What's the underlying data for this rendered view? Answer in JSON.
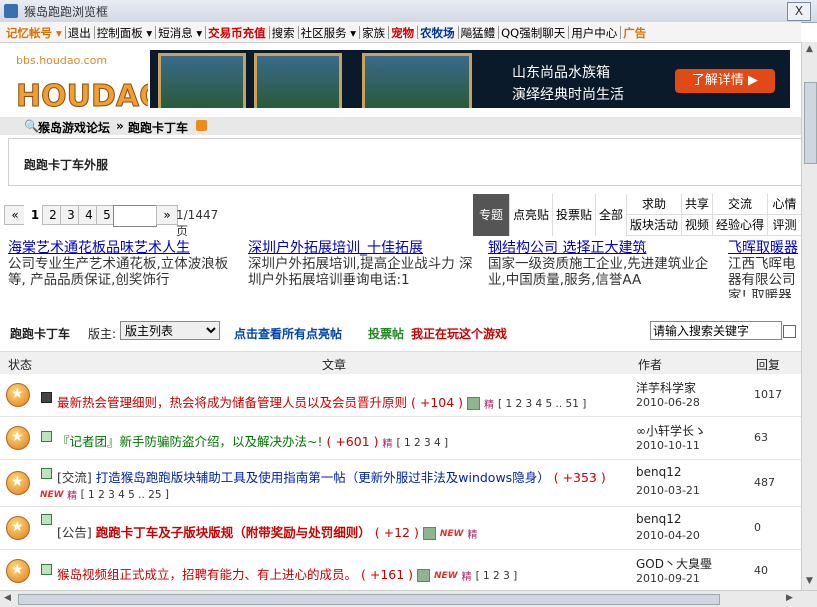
{
  "window": {
    "title": "猴岛跑跑浏览框",
    "close": "X"
  },
  "menu": [
    {
      "label": "记忆帐号 ▾",
      "style": "orange"
    },
    {
      "label": "退出",
      "style": ""
    },
    {
      "label": "控制面板 ▾",
      "style": ""
    },
    {
      "label": "短消息 ▾",
      "style": ""
    },
    {
      "label": "交易币充值",
      "style": "red"
    },
    {
      "label": "搜索",
      "style": ""
    },
    {
      "label": "社区服务 ▾",
      "style": ""
    },
    {
      "label": "家族",
      "style": ""
    },
    {
      "label": "宠物",
      "style": "red"
    },
    {
      "label": "农牧场",
      "style": "blueb"
    },
    {
      "label": "飚猛鳢",
      "style": ""
    },
    {
      "label": "QQ强制聊天",
      "style": ""
    },
    {
      "label": "用户中心",
      "style": ""
    },
    {
      "label": "广告",
      "style": "orange"
    }
  ],
  "logo": {
    "url_text": "bbs.houdao.com",
    "brand": "HOUDAO"
  },
  "banner": {
    "line1": "山东尚品水族箱",
    "line2": "演绎经典时尚生活",
    "button": "了解详情 ▶"
  },
  "breadcrumb": {
    "forum": "猴岛游戏论坛",
    "sep": "»",
    "board": "跑跑卡丁车"
  },
  "subforum": "跑跑卡丁车外服",
  "pager": {
    "first": "«",
    "pages": [
      "1",
      "2",
      "3",
      "4",
      "5"
    ],
    "next": "»",
    "total": "1/1447页"
  },
  "filters": {
    "big": [
      "专题",
      "点亮贴",
      "投票贴",
      "全部"
    ],
    "top": [
      "求助",
      "共享",
      "交流",
      "心情"
    ],
    "bottom": [
      "版块活动",
      "视频",
      "经验心得",
      "评测"
    ]
  },
  "ads": [
    {
      "title": "海棠艺术通花板品味艺术人生",
      "desc": "公司专业生产艺术通花板,立体波浪板等, 产品品质保证,创奖饰行"
    },
    {
      "title": "深圳户外拓展培训_十佳拓展",
      "desc": "深圳户外拓展培训,提高企业战斗力 深圳户外拓展培训垂询电话:1"
    },
    {
      "title": "钢结构公司 选择正大建筑",
      "desc": "国家一级资质施工企业,先进建筑业企业,中国质量,服务,信誉AA"
    },
    {
      "title": "飞晖取暖器",
      "desc": "江西飞晖电器有限公司 家! 取暖器"
    }
  ],
  "toolbar": {
    "board": "跑跑卡丁车",
    "moderator_label": "版主:",
    "moderator_select": "版主列表",
    "link_all_lit": "点击查看所有点亮帖",
    "link_vote": "投票帖",
    "link_playing": "我正在玩这个游戏",
    "search_placeholder": "请输入搜索关键字"
  },
  "table_header": {
    "status": "状态",
    "article": "文章",
    "author": "作者",
    "reply": "回复"
  },
  "threads": [
    {
      "prefix": "",
      "title": "最新热会管理细则，热会将成为储备管理人员以及会员晋升原则",
      "color": "#cc0000",
      "plus": "( +104 )",
      "pages": "1 2 3 4 5 .. 51",
      "author": "洋芋科学家",
      "date": "2010-06-28",
      "replies": "1017"
    },
    {
      "prefix": "",
      "title": "『记者团』新手防骗防盗介绍，以及解决办法~!",
      "color": "#007700",
      "plus": "( +601 )",
      "pages": "1 2 3 4",
      "author": "∞小轩学长ゝ",
      "date": "2010-10-11",
      "replies": "63"
    },
    {
      "prefix": "[交流]",
      "title": "打造猴岛跑跑版块辅助工具及使用指南第一帖（更新外服过非法及windows隐身）",
      "color": "#0022aa",
      "plus": "( +353 )",
      "pages": "1 2 3 4 5 .. 25",
      "author": "benq12",
      "date": "2010-03-21",
      "replies": "487"
    },
    {
      "prefix": "[公告]",
      "title": "跑跑卡丁车及子版块版规（附带奖励与处罚细则）",
      "color": "#cc0000",
      "plus": "( +12 )",
      "pages": "",
      "author": "benq12",
      "date": "2010-04-20",
      "replies": "0"
    },
    {
      "prefix": "",
      "title": "猴岛视频组正式成立，招聘有能力、有上进心的成员。",
      "color": "#cc0000",
      "plus": "( +161 )",
      "pages": "1 2 3",
      "author": "GOD丶大臭璺",
      "date": "2010-09-21",
      "replies": "40"
    }
  ]
}
